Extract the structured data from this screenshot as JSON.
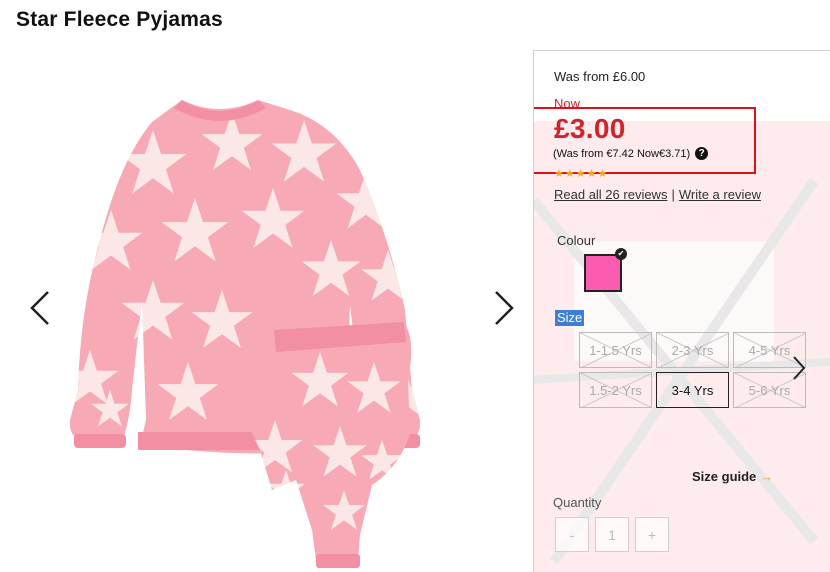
{
  "product": {
    "title": "Star Fleece Pyjamas",
    "image_alt": "pink-star-fleece-pyjamas",
    "colors": {
      "pink": "#f7a9b6",
      "star": "#fbe7e6",
      "rib": "#f38fa3"
    }
  },
  "pricing": {
    "was": "Was from £6.00",
    "now_label": "Now",
    "price": "£3.00",
    "euro": "(Was from €7.42 Now€3.71)",
    "help_icon": "?",
    "price_color": "#d0232a"
  },
  "reviews": {
    "stars": "★★★★★",
    "read_all": "Read all 26 reviews",
    "separator": "|",
    "write": "Write a review"
  },
  "colour": {
    "label": "Colour",
    "selected_swatch": "#fb5cb0",
    "check_icon": "✔"
  },
  "size": {
    "label": "Size",
    "options": [
      {
        "label": "1-1.5 Yrs",
        "state": "disabled"
      },
      {
        "label": "2-3 Yrs",
        "state": "disabled"
      },
      {
        "label": "4-5 Yrs",
        "state": "disabled"
      },
      {
        "label": "1.5-2 Yrs",
        "state": "disabled"
      },
      {
        "label": "3-4 Yrs",
        "state": "selected"
      },
      {
        "label": "5-6 Yrs",
        "state": "disabled"
      }
    ],
    "guide": "Size guide",
    "guide_arrow": "→"
  },
  "quantity": {
    "label": "Quantity",
    "minus": "-",
    "value": "1",
    "plus": "+"
  }
}
